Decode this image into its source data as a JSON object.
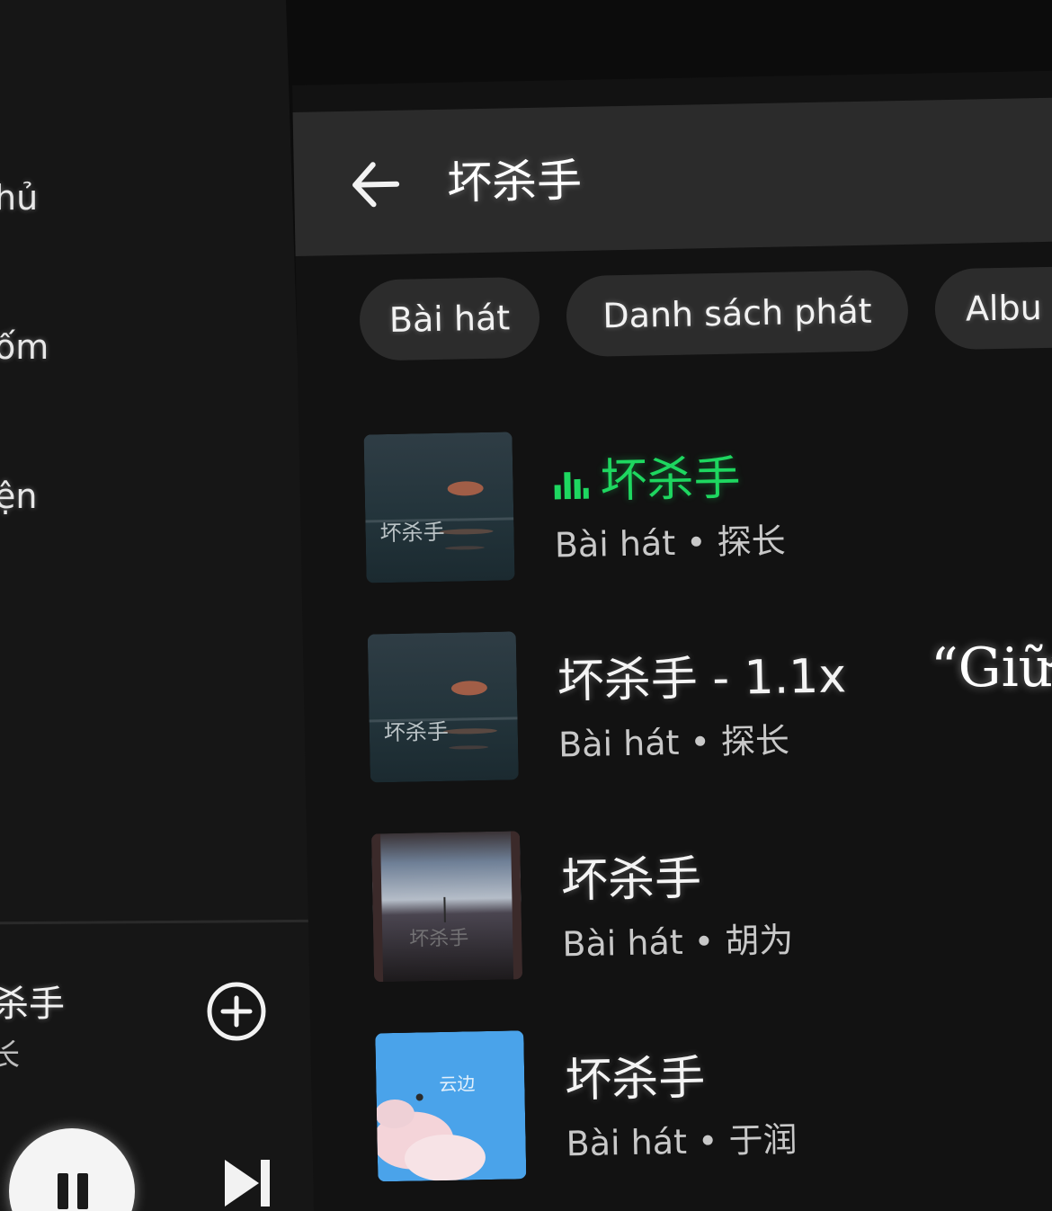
{
  "left_nav": {
    "items": [
      {
        "label": "hủ"
      },
      {
        "label": "ốm"
      },
      {
        "label": "ện"
      }
    ]
  },
  "now_playing": {
    "title": "杀手",
    "artist": "长",
    "state": "playing"
  },
  "header": {
    "title": "坏杀手"
  },
  "filter_chips": [
    {
      "label": "Bài hát"
    },
    {
      "label": "Danh sách phát"
    },
    {
      "label": "Albu"
    }
  ],
  "results": [
    {
      "title": "坏杀手",
      "subtitle": "Bài hát • 探长",
      "playing": true
    },
    {
      "title": "坏杀手 - 1.1x",
      "subtitle": "Bài hát • 探长",
      "playing": false
    },
    {
      "title": "坏杀手",
      "subtitle": "Bài hát • 胡为",
      "playing": false
    },
    {
      "title": "坏杀手",
      "subtitle": "Bài hát • 于润",
      "playing": false
    }
  ],
  "overlay": {
    "quote": "“Giữ"
  },
  "colors": {
    "accent": "#1ed760",
    "background": "#121212",
    "header_bg": "#2b2b2b",
    "chip_bg": "#2c2c2c"
  }
}
